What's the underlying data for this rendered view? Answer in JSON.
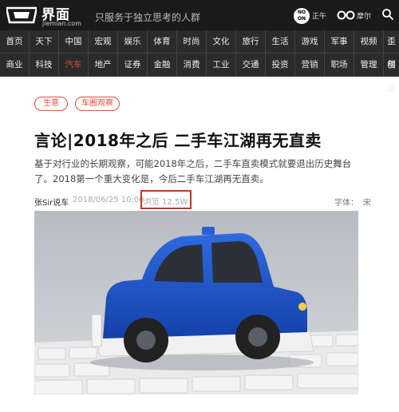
{
  "header": {
    "logo_cn": "界面",
    "logo_en": "jiemian.com",
    "slogan": "只服务于独立思考的人群",
    "no_on_badge": "NO ON",
    "no_on_label": "正午",
    "loop_label": "摩尔",
    "icons": [
      "jiemian-logo-icon",
      "no-on-icon",
      "loop-icon",
      "search-icon"
    ]
  },
  "nav": {
    "row1": [
      "首页",
      "天下",
      "中国",
      "宏观",
      "娱乐",
      "体育",
      "时尚",
      "文化",
      "旅行",
      "生活",
      "游戏",
      "军事",
      "视频",
      "歪楼"
    ],
    "row2": [
      "商业",
      "科技",
      "汽车",
      "地产",
      "证券",
      "金融",
      "消费",
      "工业",
      "交通",
      "投资",
      "营销",
      "职场",
      "管理",
      "创业"
    ]
  },
  "article": {
    "tags": [
      "生意",
      "车圈观察"
    ],
    "title": "言论|2018年之后 二手车江湖再无直卖",
    "summary": "基于对行业的长期观察，可能2018年之后，二手车直卖模式就要退出历史舞台了。2018第一个重大变化是，今后二手车江湖再无直卖。",
    "author": "张Sir说车",
    "date": "2018/06/25 10:00",
    "views": "浏览 12.5W",
    "font_label": "字体：",
    "font_value": "宋"
  },
  "colors": {
    "header_bg": "#1a1a1a",
    "nav_bg": "#2b2b2b",
    "accent_red": "#e74c3c",
    "highlight_box": "#c0392b",
    "car_blue": "#1f56c8"
  }
}
